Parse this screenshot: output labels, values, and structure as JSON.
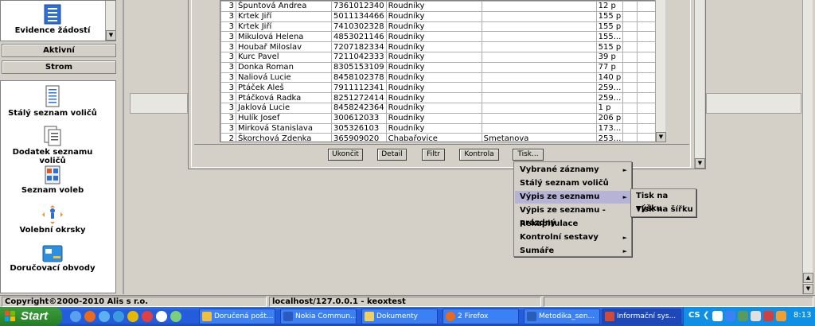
{
  "left_panel": {
    "top_item": "Evidence žádostí",
    "btn_active": "Aktivní",
    "btn_tree": "Strom",
    "items": [
      {
        "label": "Stálý seznam voličů"
      },
      {
        "label": "Dodatek seznamu voličů"
      },
      {
        "label": "Seznam voleb"
      },
      {
        "label": "Volební okrsky"
      },
      {
        "label": "Doručovací obvody"
      }
    ]
  },
  "grid": {
    "rows": [
      [
        "3",
        "Špuntová Andrea",
        "7361012340",
        "Roudníky",
        "",
        "12 p"
      ],
      [
        "3",
        "Krtek Jiří",
        "5011134466",
        "Roudníky",
        "",
        "155 p"
      ],
      [
        "3",
        "Krtek Jiří",
        "7410302328",
        "Roudníky",
        "",
        "155 p"
      ],
      [
        "3",
        "Mikulová Helena",
        "4853021146",
        "Roudníky",
        "",
        "155..."
      ],
      [
        "3",
        "Houbař Miloslav",
        "7207182334",
        "Roudníky",
        "",
        "515 p"
      ],
      [
        "3",
        "Kurc Pavel",
        "7211042333",
        "Roudníky",
        "",
        "39 p"
      ],
      [
        "3",
        "Donka Roman",
        "8305153109",
        "Roudníky",
        "",
        "77 p"
      ],
      [
        "3",
        "Naliová Lucie",
        "8458102378",
        "Roudníky",
        "",
        "140 p"
      ],
      [
        "3",
        "Ptáček Aleš",
        "7911112341",
        "Roudníky",
        "",
        "259..."
      ],
      [
        "3",
        "Ptáčková Radka",
        "8251272414",
        "Roudníky",
        "",
        "259..."
      ],
      [
        "3",
        "Jaklová Lucie",
        "8458242364",
        "Roudníky",
        "",
        "1 p"
      ],
      [
        "3",
        "Hulík Josef",
        "300612033",
        "Roudníky",
        "",
        "206 p"
      ],
      [
        "3",
        "Mirková Stanislava",
        "305326103",
        "Roudníky",
        "",
        "173..."
      ],
      [
        "2",
        "Škorchová Zdenka",
        "365909020",
        "Chabařovice",
        "Smetanova",
        "253..."
      ]
    ]
  },
  "toolbar": {
    "quit": "Ukončit",
    "detail": "Detail",
    "filter": "Filtr",
    "check": "Kontrola",
    "print": "Tisk..."
  },
  "print_menu": [
    {
      "label": "Vybrané záznamy",
      "submenu": true
    },
    {
      "label": "Stálý seznam voličů",
      "submenu": false
    },
    {
      "label": "Výpis ze seznamu",
      "submenu": true
    },
    {
      "label": "Výpis ze seznamu - prázdný",
      "submenu": false
    },
    {
      "label": "Rekapitulace",
      "submenu": false
    },
    {
      "label": "Kontrolní sestavy",
      "submenu": true
    },
    {
      "label": "Sumáře",
      "submenu": true
    }
  ],
  "sub_menu": [
    {
      "label": "Tisk na výšku"
    },
    {
      "label": "Tisk na šířku"
    }
  ],
  "status": {
    "copyright": "Copyright©2000-2010 Alis s r.o.",
    "server": "localhost/127.0.0.1 - keoxtest"
  },
  "taskbar": {
    "start": "Start",
    "tasks": [
      "Doručená pošt...",
      "Nokia Commun...",
      "Dokumenty",
      "2 Firefox",
      "Metodika_sen...",
      "Informační sys..."
    ],
    "lang": "CS",
    "clock": "8:13"
  },
  "colors": {
    "menu_highlight": "#b7b3d6",
    "taskbar": "#245ddb",
    "start": "#2f8f2f"
  }
}
